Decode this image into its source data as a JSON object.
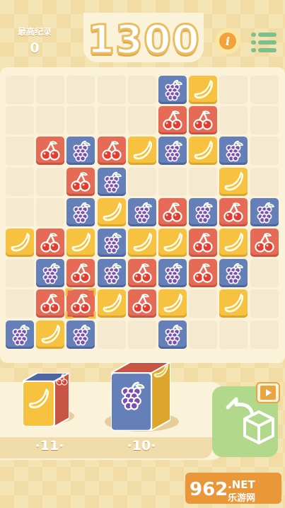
{
  "header": {
    "best_label": "最高纪录",
    "best_value": "0",
    "score": "1300",
    "tip_icon": "lightbulb-info-icon",
    "menu_icon": "list-menu-icon"
  },
  "colors": {
    "cherry_tile": "#e56b56",
    "grape_tile": "#6580b9",
    "banana_tile": "#f6c23f",
    "accent_green": "#7dc08b"
  },
  "board": {
    "cols": 9,
    "rows": 9,
    "tiles": [
      [
        null,
        null,
        null,
        null,
        null,
        "grape",
        "banana",
        null,
        null
      ],
      [
        null,
        null,
        null,
        null,
        null,
        "cherry",
        "cherry",
        null,
        null
      ],
      [
        null,
        "cherry",
        "grape",
        "cherry",
        "banana",
        "grape",
        "banana",
        "grape",
        null
      ],
      [
        null,
        null,
        "cherry",
        "grape",
        null,
        null,
        null,
        "banana",
        null
      ],
      [
        null,
        null,
        "grape",
        "banana",
        "grape",
        "cherry",
        "grape",
        "cherry",
        "grape"
      ],
      [
        "banana",
        "cherry",
        "banana",
        "grape",
        "banana",
        "banana",
        "cherry",
        "banana",
        "cherry"
      ],
      [
        null,
        "grape",
        "cherry",
        "grape",
        "cherry",
        "grape",
        "cherry",
        "grape",
        null
      ],
      [
        null,
        "cherry",
        "cherry",
        "banana",
        "cherry",
        "banana",
        null,
        "banana",
        null
      ],
      [
        "grape",
        "banana",
        "grape",
        null,
        null,
        "grape",
        null,
        null,
        null
      ]
    ],
    "selected_cell": {
      "row": 7,
      "col": 2
    }
  },
  "tray": {
    "pieces": [
      {
        "count": "·11·",
        "faces": [
          "banana",
          "cherry",
          "grape"
        ]
      },
      {
        "count": "·10·",
        "faces": [
          "grape",
          "banana",
          "cherry"
        ]
      }
    ],
    "rotate_icon": "rotate-cube-icon",
    "video_icon": "video-ad-icon"
  },
  "watermark": {
    "site": "962",
    "suffix": ".NET",
    "name": "乐游网"
  }
}
